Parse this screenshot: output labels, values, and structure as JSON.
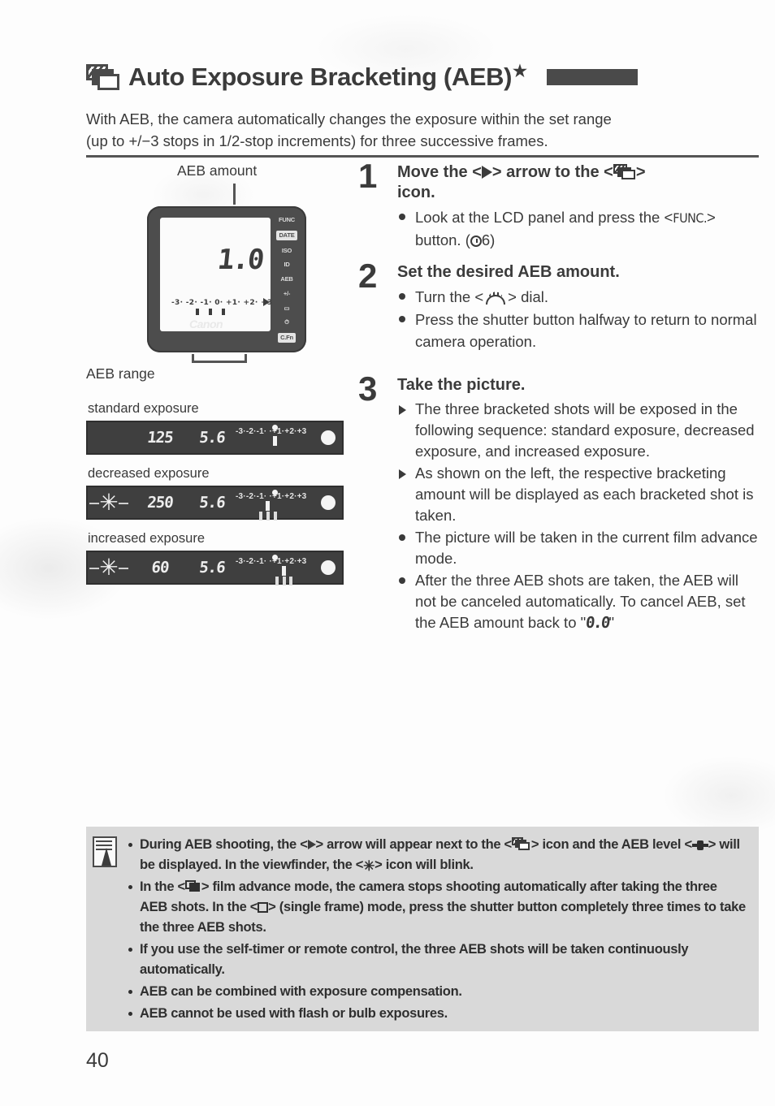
{
  "page": {
    "number": "40"
  },
  "header": {
    "icon_name": "aeb-frames-icon",
    "title": "Auto Exposure Bracketing (AEB)",
    "star": "★",
    "mode_bar": ""
  },
  "intro": {
    "line1": "With AEB, the camera automatically changes the exposure within the set range",
    "line2": "(up to +/−3 stops in 1/2-stop increments) for three successive frames."
  },
  "illustration": {
    "amount_label": "AEB amount",
    "range_label": "AEB range",
    "lcd": {
      "digits": "1.0",
      "scale_text": "-3· -2· -1· 0· +1· +2· +3",
      "brand": "Canon",
      "side_icons": [
        "FUNC",
        "DATE",
        "ISO",
        "ID",
        "AEB",
        "+/-",
        "▭",
        "⏱",
        "C.Fn"
      ]
    },
    "viewfinders": [
      {
        "caption": "standard exposure",
        "shutter": "125",
        "aperture": "5.6",
        "scale_text": "-3·-2·-1· ·+1·+2·+3",
        "star_visible": false,
        "marker_pct": 47,
        "dot_pct": 45,
        "upticks": []
      },
      {
        "caption": "decreased exposure",
        "shutter": "250",
        "aperture": "5.6",
        "scale_text": "-3·-2·-1· ·+1·+2·+3",
        "star_visible": true,
        "marker_pct": 38,
        "dot_pct": 45,
        "upticks": [
          30,
          38,
          47
        ]
      },
      {
        "caption": "increased exposure",
        "shutter": "60",
        "aperture": "5.6",
        "scale_text": "-3·-2·-1· ·+1·+2·+3",
        "star_visible": true,
        "marker_pct": 56,
        "dot_pct": 45,
        "upticks": [
          49,
          56,
          65
        ]
      }
    ]
  },
  "steps": [
    {
      "number": "1",
      "title_pre": "Move the <",
      "title_mid": "> arrow to the <",
      "title_post": ">",
      "title_line2": "icon.",
      "bullets": [
        {
          "marker": "dot",
          "pre": "Look at the LCD panel and press the <",
          "token": "FUNC.",
          "post": "> button. (",
          "tail": "6)"
        }
      ]
    },
    {
      "number": "2",
      "title": "Set the desired AEB amount.",
      "bullets": [
        {
          "marker": "dot",
          "pre": "Turn the <",
          "post": "> dial."
        },
        {
          "marker": "dot",
          "text": "Press the shutter button halfway to return to normal camera operation."
        }
      ]
    },
    {
      "number": "3",
      "title": "Take the picture.",
      "bullets": [
        {
          "marker": "triangle",
          "text": "The three bracketed shots will be exposed in the following sequence: standard exposure, decreased exposure, and increased exposure."
        },
        {
          "marker": "triangle",
          "text": "As shown on the left, the respective bracketing amount will be displayed as each bracketed shot is taken."
        },
        {
          "marker": "dot",
          "text": "The picture will be taken in the current film advance mode."
        },
        {
          "marker": "dot",
          "pre": "After the three AEB shots are taken, the AEB will not be canceled automatically. To cancel AEB, set the AEB amount back to \"",
          "lcd": "0.0",
          "post": "\""
        }
      ]
    }
  ],
  "notes": {
    "icon_name": "notepad-pen-icon",
    "items": [
      {
        "p1": "During AEB shooting, the <",
        "p2": "> arrow will appear next to the <",
        "p3": "> icon and the AEB level <",
        "p4": "> will be displayed. In the viewfinder, the <",
        "p5": "> icon will blink."
      },
      {
        "p1": "In the <",
        "p2": "> film advance mode, the camera stops shooting automatically after taking the three AEB shots. In the <",
        "p3": "> (single frame) mode, press the shutter button completely three times to take the three AEB shots."
      },
      {
        "text": "If you use the self-timer or remote control, the three AEB shots will be taken continuously automatically."
      },
      {
        "text": "AEB can be combined with exposure compensation."
      },
      {
        "text": "AEB cannot be used with flash or bulb exposures."
      }
    ]
  }
}
